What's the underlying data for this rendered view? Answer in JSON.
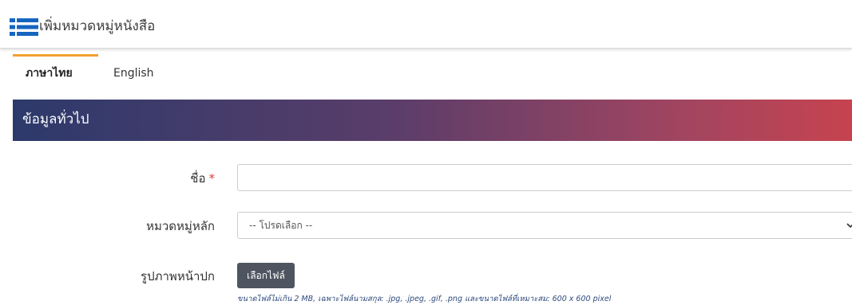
{
  "header": {
    "title": "เพิ่มหมวดหมู่หนังสือ",
    "icon": "list-icon"
  },
  "tabs": [
    {
      "label": "ภาษาไทย",
      "active": true
    },
    {
      "label": "English",
      "active": false
    }
  ],
  "section": {
    "title": "ข้อมูลทั่วไป"
  },
  "form": {
    "name": {
      "label": "ชื่อ",
      "required_mark": "*",
      "value": ""
    },
    "main_category": {
      "label": "หมวดหมู่หลัก",
      "selected": "-- โปรดเลือก --"
    },
    "cover_image": {
      "label": "รูปภาพหน้าปก",
      "button_label": "เลือกไฟล์",
      "help_text": "ขนาดไฟล์ไม่เกิน 2 MB, เฉพาะไฟล์นามสกุล: .jpg, .jpeg, .gif, .png และขนาดไฟล์ที่เหมาะสม: 600 x 600 pixel"
    }
  },
  "colors": {
    "tab_accent": "#f0a030",
    "banner_gradient_start": "#2c3a6b",
    "banner_gradient_end": "#c6434f",
    "icon_blue": "#1565c0",
    "required": "#e53935"
  }
}
